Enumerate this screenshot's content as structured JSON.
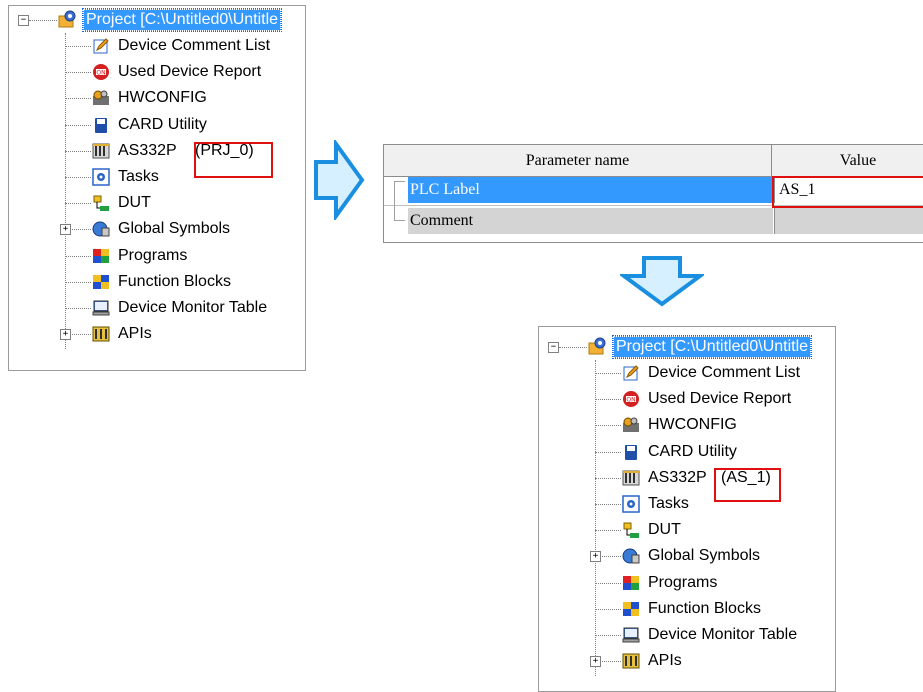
{
  "tree_before": {
    "root_label": "Project [C:\\Untitled0\\Untitle",
    "items": [
      {
        "label": "Device Comment List",
        "icon": "edit-document-icon"
      },
      {
        "label": "Used Device Report",
        "icon": "device-report-icon"
      },
      {
        "label": "HWCONFIG",
        "icon": "hwconfig-icon"
      },
      {
        "label": "CARD Utility",
        "icon": "card-icon"
      },
      {
        "label": "AS332P",
        "suffix": "(PRJ_0)",
        "icon": "plc-icon"
      },
      {
        "label": "Tasks",
        "icon": "tasks-icon"
      },
      {
        "label": "DUT",
        "icon": "dut-icon"
      },
      {
        "label": "Global Symbols",
        "icon": "global-symbols-icon",
        "expandable": true
      },
      {
        "label": "Programs",
        "icon": "programs-icon"
      },
      {
        "label": "Function Blocks",
        "icon": "function-blocks-icon"
      },
      {
        "label": "Device Monitor Table",
        "icon": "monitor-icon"
      },
      {
        "label": "APIs",
        "icon": "apis-icon",
        "expandable": true
      }
    ]
  },
  "parameter_grid": {
    "columns": [
      "Parameter name",
      "Value"
    ],
    "rows": [
      {
        "name": "PLC Label",
        "value": "AS_1",
        "selected": true
      },
      {
        "name": "Comment",
        "value": "",
        "selected": false
      }
    ]
  },
  "tree_after": {
    "root_label": "Project [C:\\Untitled0\\Untitle",
    "items": [
      {
        "label": "Device Comment List",
        "icon": "edit-document-icon"
      },
      {
        "label": "Used Device Report",
        "icon": "device-report-icon"
      },
      {
        "label": "HWCONFIG",
        "icon": "hwconfig-icon"
      },
      {
        "label": "CARD Utility",
        "icon": "card-icon"
      },
      {
        "label": "AS332P",
        "suffix": "(AS_1)",
        "icon": "plc-icon"
      },
      {
        "label": "Tasks",
        "icon": "tasks-icon"
      },
      {
        "label": "DUT",
        "icon": "dut-icon"
      },
      {
        "label": "Global Symbols",
        "icon": "global-symbols-icon",
        "expandable": true
      },
      {
        "label": "Programs",
        "icon": "programs-icon"
      },
      {
        "label": "Function Blocks",
        "icon": "function-blocks-icon"
      },
      {
        "label": "Device Monitor Table",
        "icon": "monitor-icon"
      },
      {
        "label": "APIs",
        "icon": "apis-icon",
        "expandable": true
      }
    ]
  },
  "colors": {
    "selection": "#3399ff",
    "highlight_box": "#e01010",
    "arrow_fill": "#d6f0ff",
    "arrow_stroke": "#1a8fe0"
  }
}
